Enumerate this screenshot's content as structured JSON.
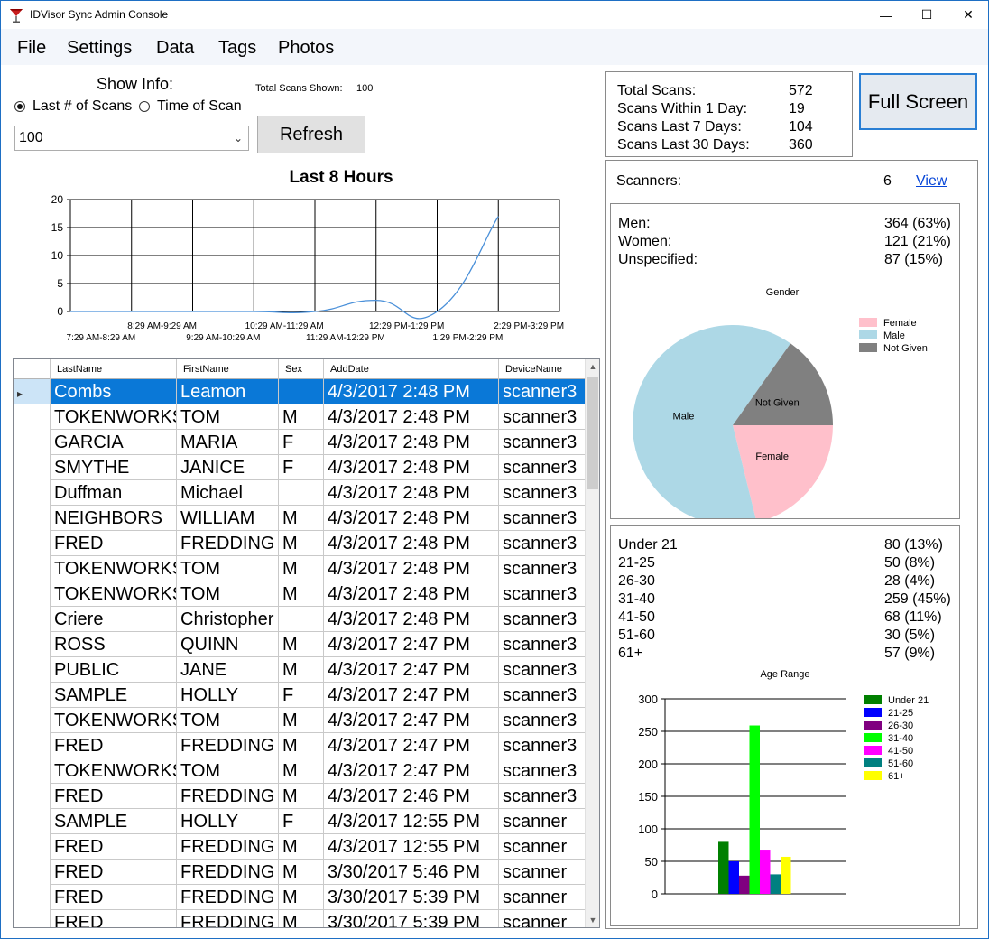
{
  "window": {
    "title": "IDVisor Sync Admin Console",
    "minimize": "—",
    "maximize": "☐",
    "close": "✕"
  },
  "menu": {
    "file": "File",
    "settings": "Settings",
    "data": "Data",
    "tags": "Tags",
    "photos": "Photos"
  },
  "controls": {
    "show_info_label": "Show Info:",
    "radio_last_scans": "Last # of Scans",
    "radio_time_of_scan": "Time of Scan",
    "selected_mode": "last_scans",
    "total_shown_label": "Total Scans Shown:",
    "total_shown_value": "100",
    "count_select_value": "100",
    "refresh_label": "Refresh",
    "full_screen_label": "Full Screen"
  },
  "summary": {
    "total_label": "Total Scans:",
    "total_value": "572",
    "day_label": "Scans Within 1 Day:",
    "day_value": "19",
    "week_label": "Scans Last 7 Days:",
    "week_value": "104",
    "month_label": "Scans Last 30 Days:",
    "month_value": "360"
  },
  "scanners": {
    "label": "Scanners:",
    "value": "6",
    "link": "View"
  },
  "gender": {
    "men_label": "Men:",
    "men_value": "364 (63%)",
    "women_label": "Women:",
    "women_value": "121 (21%)",
    "unspec_label": "Unspecified:",
    "unspec_value": "87 (15%)"
  },
  "age": {
    "rows": [
      {
        "label": "Under 21",
        "value": "80 (13%)"
      },
      {
        "label": "21-25",
        "value": "50 (8%)"
      },
      {
        "label": "26-30",
        "value": "28 (4%)"
      },
      {
        "label": "31-40",
        "value": "259 (45%)"
      },
      {
        "label": "41-50",
        "value": "68 (11%)"
      },
      {
        "label": "51-60",
        "value": "30 (5%)"
      },
      {
        "label": "61+",
        "value": "57 (9%)"
      }
    ]
  },
  "colors": {
    "line": "#4a90d9",
    "selection": "#0a78d7",
    "female": "#ffc0cb",
    "male": "#add8e6",
    "not_given": "#808080",
    "age": [
      "#008000",
      "#0000ff",
      "#800080",
      "#00ff00",
      "#ff00ff",
      "#008080",
      "#ffff00"
    ]
  },
  "grid": {
    "headers": [
      "LastName",
      "FirstName",
      "Sex",
      "AddDate",
      "DeviceName"
    ],
    "rows": [
      [
        "Combs",
        "Leamon",
        "",
        "4/3/2017 2:48 PM",
        "scanner3"
      ],
      [
        "TOKENWORKS",
        "TOM",
        "M",
        "4/3/2017 2:48 PM",
        "scanner3"
      ],
      [
        "GARCIA",
        "MARIA",
        "F",
        "4/3/2017 2:48 PM",
        "scanner3"
      ],
      [
        "SMYTHE",
        "JANICE",
        "F",
        "4/3/2017 2:48 PM",
        "scanner3"
      ],
      [
        "Duffman",
        "Michael",
        "",
        "4/3/2017 2:48 PM",
        "scanner3"
      ],
      [
        "NEIGHBORS",
        "WILLIAM",
        "M",
        "4/3/2017 2:48 PM",
        "scanner3"
      ],
      [
        "FRED",
        "FREDDING",
        "M",
        "4/3/2017 2:48 PM",
        "scanner3"
      ],
      [
        "TOKENWORKS",
        "TOM",
        "M",
        "4/3/2017 2:48 PM",
        "scanner3"
      ],
      [
        "TOKENWORKS",
        "TOM",
        "M",
        "4/3/2017 2:48 PM",
        "scanner3"
      ],
      [
        "Criere",
        "Christopher",
        "",
        "4/3/2017 2:48 PM",
        "scanner3"
      ],
      [
        "ROSS",
        "QUINN",
        "M",
        "4/3/2017 2:47 PM",
        "scanner3"
      ],
      [
        "PUBLIC",
        "JANE",
        "M",
        "4/3/2017 2:47 PM",
        "scanner3"
      ],
      [
        "SAMPLE",
        "HOLLY",
        "F",
        "4/3/2017 2:47 PM",
        "scanner3"
      ],
      [
        "TOKENWORKS",
        "TOM",
        "M",
        "4/3/2017 2:47 PM",
        "scanner3"
      ],
      [
        "FRED",
        "FREDDING",
        "M",
        "4/3/2017 2:47 PM",
        "scanner3"
      ],
      [
        "TOKENWORKS",
        "TOM",
        "M",
        "4/3/2017 2:47 PM",
        "scanner3"
      ],
      [
        "FRED",
        "FREDDING",
        "M",
        "4/3/2017 2:46 PM",
        "scanner3"
      ],
      [
        "SAMPLE",
        "HOLLY",
        "F",
        "4/3/2017 12:55 PM",
        "scanner"
      ],
      [
        "FRED",
        "FREDDING",
        "M",
        "4/3/2017 12:55 PM",
        "scanner"
      ],
      [
        "FRED",
        "FREDDING",
        "M",
        "3/30/2017 5:46 PM",
        "scanner"
      ],
      [
        "FRED",
        "FREDDING",
        "M",
        "3/30/2017 5:39 PM",
        "scanner"
      ],
      [
        "FRED",
        "FREDDING",
        "M",
        "3/30/2017 5:39 PM",
        "scanner"
      ]
    ]
  },
  "chart_data": [
    {
      "type": "line",
      "title": "Last 8 Hours",
      "categories": [
        "7:29 AM-8:29 AM",
        "8:29 AM-9:29 AM",
        "9:29 AM-10:29 AM",
        "10:29 AM-11:29 AM",
        "11:29 AM-12:29 PM",
        "12:29 PM-1:29 PM",
        "1:29 PM-2:29 PM",
        "2:29 PM-3:29 PM"
      ],
      "values": [
        0,
        0,
        0,
        0,
        0,
        2,
        0,
        17
      ],
      "ylim": [
        0,
        20
      ],
      "yticks": [
        0,
        5,
        10,
        15,
        20
      ],
      "grid": true
    },
    {
      "type": "pie",
      "title": "Gender",
      "labels": [
        "Female",
        "Male",
        "Not Given"
      ],
      "values": [
        121,
        364,
        87
      ],
      "legend": [
        "Female",
        "Male",
        "Not Given"
      ],
      "legend_position": "top-right"
    },
    {
      "type": "bar",
      "title": "Age Range",
      "series": [
        {
          "name": "Under 21",
          "values": [
            80
          ]
        },
        {
          "name": "21-25",
          "values": [
            50
          ]
        },
        {
          "name": "26-30",
          "values": [
            28
          ]
        },
        {
          "name": "31-40",
          "values": [
            259
          ]
        },
        {
          "name": "41-50",
          "values": [
            68
          ]
        },
        {
          "name": "51-60",
          "values": [
            30
          ]
        },
        {
          "name": "61+",
          "values": [
            57
          ]
        }
      ],
      "ylim": [
        0,
        300
      ],
      "yticks": [
        0,
        50,
        100,
        150,
        200,
        250,
        300
      ],
      "grid": true,
      "legend_position": "right"
    }
  ]
}
